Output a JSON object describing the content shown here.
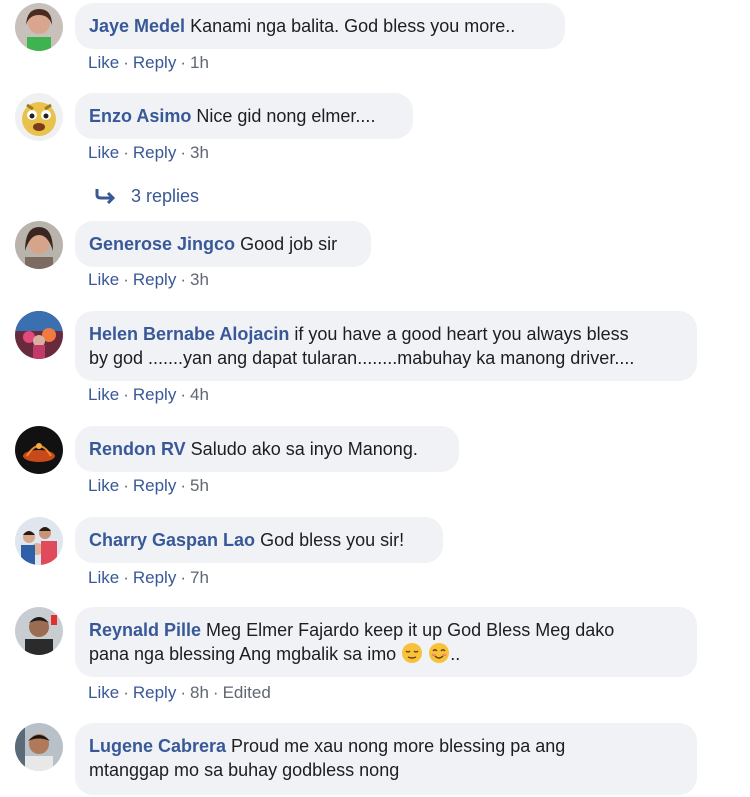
{
  "comments": [
    {
      "author": "Jaye Medel",
      "text": "Kanami nga balita. God bless you more..",
      "like": "Like",
      "reply": "Reply",
      "time": "1h"
    },
    {
      "author": "Enzo Asimo",
      "text": "Nice gid nong elmer....",
      "like": "Like",
      "reply": "Reply",
      "time": "3h"
    },
    {
      "author": "Generose Jingco",
      "text": "Good job sir",
      "like": "Like",
      "reply": "Reply",
      "time": "3h"
    },
    {
      "author": "Helen Bernabe Alojacin",
      "text_line1": "if you have a good heart you always bless",
      "text_line2": "by god .......yan ang dapat tularan........mabuhay ka manong driver....",
      "like": "Like",
      "reply": "Reply",
      "time": "4h"
    },
    {
      "author": "Rendon RV",
      "text": "Saludo ako sa inyo Manong.",
      "like": "Like",
      "reply": "Reply",
      "time": "5h"
    },
    {
      "author": "Charry Gaspan Lao",
      "text": "God bless you sir!",
      "like": "Like",
      "reply": "Reply",
      "time": "7h"
    },
    {
      "author": "Reynald Pille",
      "text_line1": "Meg Elmer Fajardo keep it up God Bless Meg dako",
      "text_line2": "pana nga blessing Ang mgbalik sa imo",
      "text_suffix": "..",
      "like": "Like",
      "reply": "Reply",
      "time": "8h",
      "edited": "Edited"
    },
    {
      "author": "Lugene Cabrera",
      "text_line1": "Proud me xau nong more blessing pa ang",
      "text_line2": "mtanggap mo sa buhay godbless nong"
    }
  ],
  "replies_link": "3 replies",
  "separator": "·",
  "colors": {
    "link": "#385898",
    "bubble": "#f0f2f5",
    "meta": "#606770"
  },
  "icons": [
    "reply-arrow-icon",
    "relieved-face-emoji",
    "smiling-face-emoji"
  ]
}
